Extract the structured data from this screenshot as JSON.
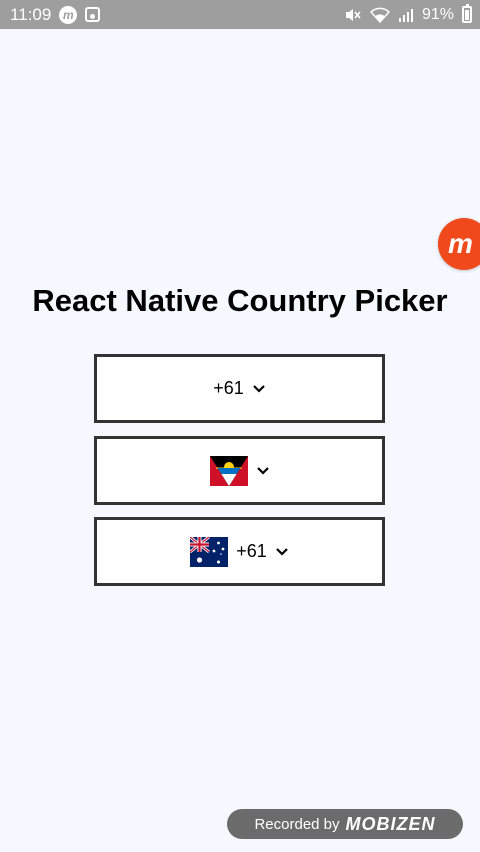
{
  "status_bar": {
    "time": "11:09",
    "battery": "91%",
    "icons": [
      "mobizen-icon",
      "gallery-icon",
      "mute-icon",
      "wifi-icon",
      "signal-icon",
      "battery-icon"
    ]
  },
  "title": "React Native Country Picker",
  "pickers": [
    {
      "code": "+61",
      "flag": null
    },
    {
      "code": "",
      "flag": "antigua-and-barbuda"
    },
    {
      "code": "+61",
      "flag": "australia"
    }
  ],
  "overlay": {
    "bubble": "m",
    "recorded_label": "Recorded by",
    "brand": "MOBIZEN"
  },
  "colors": {
    "background": "#f5f9ff",
    "status_bar": "#9e9e9e",
    "picker_border": "#333333",
    "mobizen_orange": "#f0491c"
  }
}
